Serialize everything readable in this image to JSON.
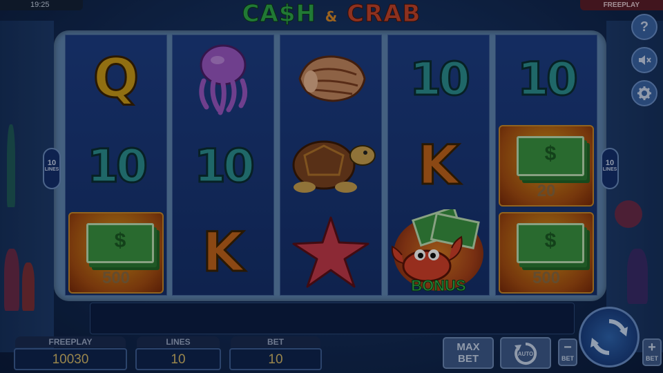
{
  "status": {
    "time": "19:25",
    "mode": "FREEPLAY"
  },
  "logo": {
    "cash": "CA$H",
    "amp": "&",
    "crab": "CRAB"
  },
  "reels": [
    [
      {
        "type": "letter",
        "text": "Q",
        "icon": "q-icon"
      },
      {
        "type": "number",
        "text": "10",
        "icon": "ten-icon"
      },
      {
        "type": "cash",
        "value": "500",
        "icon": "cash-stack-icon"
      }
    ],
    [
      {
        "type": "icon",
        "icon": "jellyfish-icon"
      },
      {
        "type": "number",
        "text": "10",
        "icon": "ten-icon"
      },
      {
        "type": "letter",
        "text": "K",
        "icon": "k-icon"
      }
    ],
    [
      {
        "type": "icon",
        "icon": "seashell-icon"
      },
      {
        "type": "icon",
        "icon": "turtle-icon"
      },
      {
        "type": "icon",
        "icon": "starfish-icon"
      }
    ],
    [
      {
        "type": "number",
        "text": "10",
        "icon": "ten-icon"
      },
      {
        "type": "letter",
        "text": "K",
        "icon": "k-icon"
      },
      {
        "type": "bonus",
        "text": "BONUS",
        "icon": "crab-bonus-icon"
      }
    ],
    [
      {
        "type": "number",
        "text": "10",
        "icon": "ten-icon"
      },
      {
        "type": "cash",
        "value": "20",
        "icon": "cash-stack-icon"
      },
      {
        "type": "cash",
        "value": "500",
        "icon": "cash-stack-icon"
      }
    ]
  ],
  "lines_badge": {
    "number": "10",
    "label": "LINES"
  },
  "panel": {
    "freeplay": {
      "label": "FREEPLAY",
      "value": "10030"
    },
    "lines": {
      "label": "LINES",
      "value": "10"
    },
    "bet": {
      "label": "BET",
      "value": "10"
    }
  },
  "buttons": {
    "max_bet_top": "MAX",
    "max_bet_bottom": "BET",
    "auto": "AUTO",
    "bet_minus": "−",
    "bet_plus": "+",
    "bet_label": "BET",
    "help": "?"
  },
  "colors": {
    "cash_green": "#2fa84a",
    "crab_red": "#c4442c",
    "accent_gold": "#d6ba6a"
  }
}
